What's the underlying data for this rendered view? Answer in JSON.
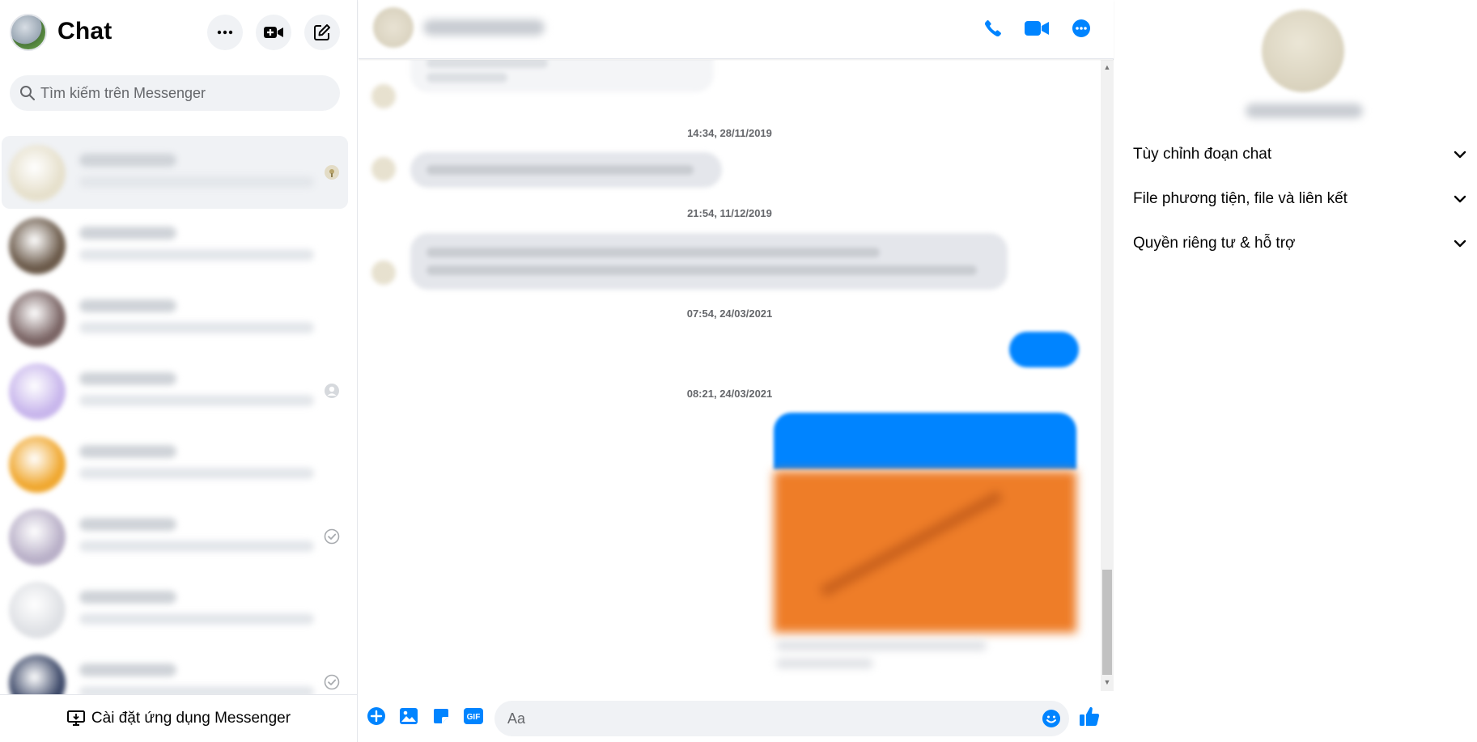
{
  "sidebar": {
    "title": "Chat",
    "search": {
      "placeholder": "Tìm kiếm trên Messenger"
    },
    "install_label": "Cài đặt ứng dụng Messenger",
    "conversations": [
      {
        "avatar_color": "#e6e0cc",
        "status": "avatar",
        "active": true
      },
      {
        "avatar_color": "#6b5a4a",
        "status": "none",
        "active": false
      },
      {
        "avatar_color": "#7a6464",
        "status": "none",
        "active": false
      },
      {
        "avatar_color": "#c8b6ec",
        "status": "gray-avatar",
        "active": false
      },
      {
        "avatar_color": "#f0a830",
        "status": "none",
        "active": false
      },
      {
        "avatar_color": "#b9b0c8",
        "status": "check",
        "active": false
      },
      {
        "avatar_color": "#dfe1e5",
        "status": "none",
        "active": false
      },
      {
        "avatar_color": "#3c4868",
        "status": "check",
        "active": false
      }
    ]
  },
  "chat": {
    "timestamps": [
      "14:34, 28/11/2019",
      "21:54, 11/12/2019",
      "07:54, 24/03/2021",
      "08:21, 24/03/2021"
    ],
    "composer_placeholder": "Aa"
  },
  "info_panel": {
    "sections": [
      "Tùy chỉnh đoạn chat",
      "File phương tiện, file và liên kết",
      "Quyền riêng tư & hỗ trợ"
    ]
  },
  "colors": {
    "accent": "#0084ff",
    "bubble_incoming": "#e4e6eb",
    "photo": "#ee7d28"
  }
}
